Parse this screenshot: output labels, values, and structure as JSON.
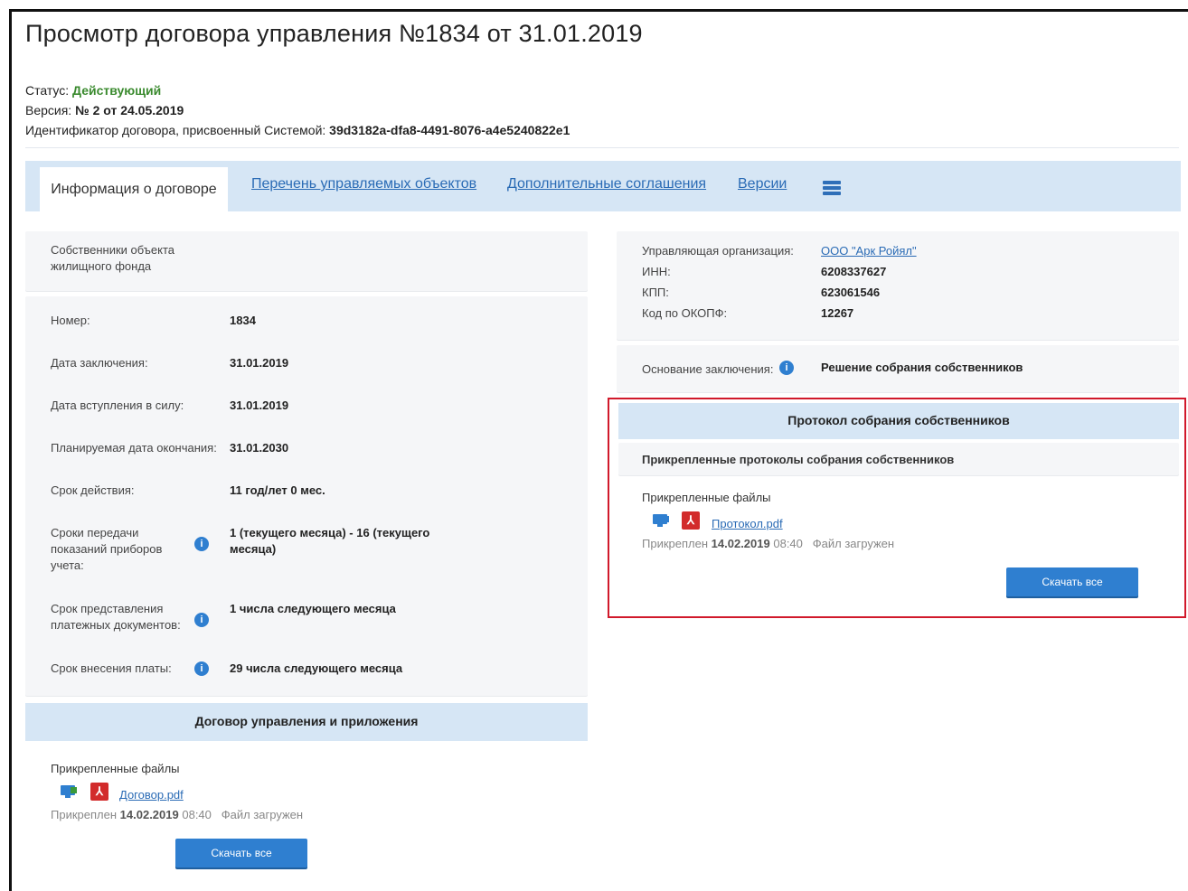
{
  "page": {
    "title": "Просмотр договора управления №1834 от 31.01.2019",
    "status_label": "Статус:",
    "status_value": "Действующий",
    "version_label": "Версия:",
    "version_value": "№ 2 от 24.05.2019",
    "id_label": "Идентификатор договора, присвоенный Системой:",
    "id_value": "39d3182a-dfa8-4491-8076-a4e5240822e1"
  },
  "tabs": [
    {
      "label": "Информация о договоре"
    },
    {
      "label": "Перечень управляемых объектов"
    },
    {
      "label": "Дополнительные соглашения"
    },
    {
      "label": "Версии"
    }
  ],
  "left": {
    "owners_label": "Собственники объекта жилищного фонда",
    "fields": [
      {
        "label": "Номер:",
        "value": "1834"
      },
      {
        "label": "Дата заключения:",
        "value": "31.01.2019"
      },
      {
        "label": "Дата вступления в силу:",
        "value": "31.01.2019"
      },
      {
        "label": "Планируемая дата окончания:",
        "value": "31.01.2030"
      },
      {
        "label": "Срок действия:",
        "value": "11 год/лет 0 мес."
      },
      {
        "label": "Сроки передачи показаний приборов учета:",
        "value": "1 (текущего месяца) - 16 (текущего месяца)"
      },
      {
        "label": "Срок представления платежных документов:",
        "value": "1 числа следующего месяца"
      },
      {
        "label": "Срок внесения платы:",
        "value": "29 числа следующего месяца"
      }
    ],
    "contract_header": "Договор управления и приложения",
    "files_label": "Прикрепленные файлы",
    "file_name": "Договор.pdf",
    "attached_prefix": "Прикреплен",
    "attached_date": "14.02.2019",
    "attached_time": "08:40",
    "file_status": "Файл загружен",
    "download_all": "Скачать все"
  },
  "right": {
    "org_label": "Управляющая организация:",
    "org_value": "ООО \"Арк Ройял\"",
    "inn_label": "ИНН:",
    "inn_value": "6208337627",
    "kpp_label": "КПП:",
    "kpp_value": "623061546",
    "okopf_label": "Код по ОКОПФ:",
    "okopf_value": "12267",
    "basis_label": "Основание заключения:",
    "basis_value": "Решение собрания собственников",
    "protocol_header": "Протокол собрания собственников",
    "protocols_label": "Прикрепленные протоколы собрания собственников",
    "files_label": "Прикрепленные файлы",
    "file_name": "Протокол.pdf",
    "attached_prefix": "Прикреплен",
    "attached_date": "14.02.2019",
    "attached_time": "08:40",
    "file_status": "Файл загружен",
    "download_all": "Скачать все"
  },
  "icons": {
    "info": "info-icon",
    "pdf": "pdf-icon",
    "monitor": "monitor-icon",
    "list": "list-icon"
  }
}
